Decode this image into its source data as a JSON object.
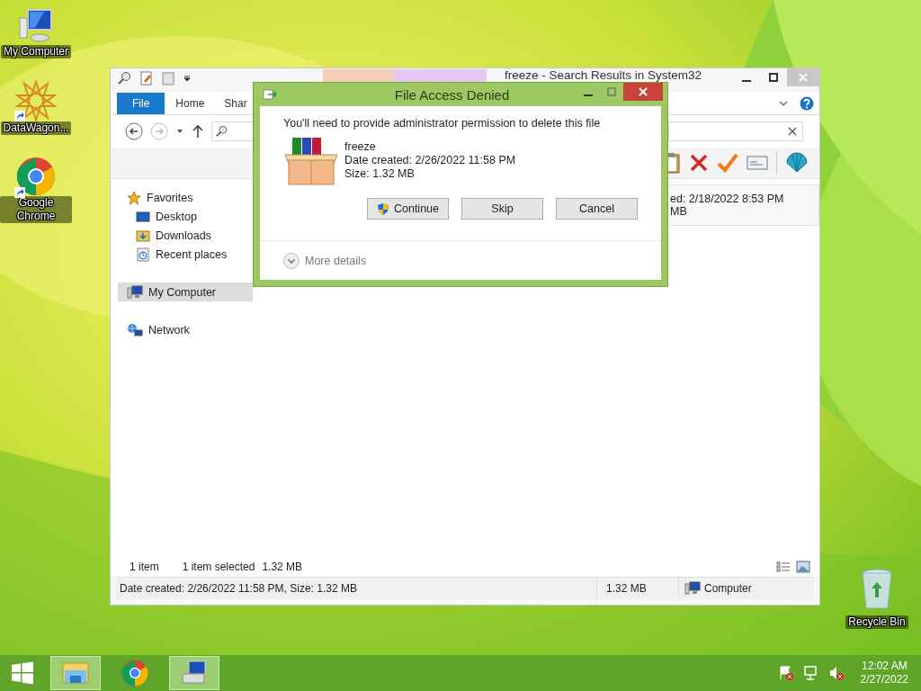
{
  "desktop_icons": [
    {
      "label": "My Computer",
      "kind": "computer",
      "shortcut": false
    },
    {
      "label": "DataWagon...",
      "kind": "star",
      "shortcut": true
    },
    {
      "label": "Google Chrome",
      "kind": "chrome",
      "shortcut": true
    }
  ],
  "recycle_bin": {
    "label": "Recycle Bin"
  },
  "explorer": {
    "title": "freeze - Search Results in System32",
    "tabs": [
      {
        "label": "File",
        "selected": true
      },
      {
        "label": "Home",
        "selected": false
      },
      {
        "label": "Shar",
        "selected": false
      }
    ],
    "sidebar": [
      {
        "label": "Favorites",
        "kind": "star",
        "selected": false,
        "children": [
          {
            "label": "Desktop",
            "kind": "desktop",
            "selected": false
          },
          {
            "label": "Downloads",
            "kind": "folder",
            "selected": false
          },
          {
            "label": "Recent places",
            "kind": "recent",
            "selected": false
          }
        ]
      },
      {
        "label": "My Computer",
        "kind": "computer",
        "selected": true
      },
      {
        "label": "Network",
        "kind": "network",
        "selected": false
      }
    ],
    "result_row": {
      "column_1": "ed: 2/18/2022 8:53 PM",
      "column_2": "MB"
    },
    "item_count": "1 item",
    "selection_count": "1 item selected",
    "selection_size": "1.32 MB",
    "status_bar": {
      "details": "Date created: 2/26/2022 11:58 PM, Size: 1.32 MB",
      "size": "1.32 MB",
      "location": "Computer"
    }
  },
  "dialog": {
    "title": "File Access Denied",
    "message": "You'll need to provide administrator permission to delete this file",
    "file": {
      "name": "freeze",
      "date_created": "Date created: 2/26/2022 11:58 PM",
      "size": "Size: 1.32 MB"
    },
    "buttons": [
      {
        "label": "Continue",
        "shield": true
      },
      {
        "label": "Skip",
        "shield": false
      },
      {
        "label": "Cancel",
        "shield": false
      }
    ],
    "more_details": "More details"
  },
  "taskbar": {
    "apps": [
      {
        "kind": "explorer",
        "selected": true
      },
      {
        "kind": "chrome",
        "selected": false
      },
      {
        "kind": "computer",
        "selected": true
      }
    ],
    "time": "12:02 AM",
    "date": "2/27/2022"
  }
}
